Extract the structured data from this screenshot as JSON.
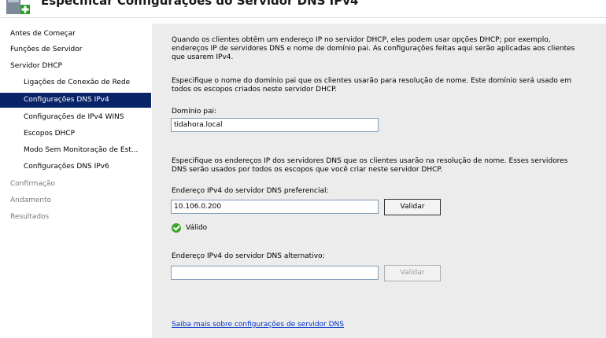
{
  "header": {
    "title": "Especificar Configurações do Servidor DNS IPv4"
  },
  "sidebar": {
    "items": [
      {
        "label": "Antes de Começar",
        "state": "normal"
      },
      {
        "label": "Funções de Servidor",
        "state": "normal"
      },
      {
        "label": "Servidor DHCP",
        "state": "normal"
      },
      {
        "label": "Ligações de Conexão de Rede",
        "state": "normal"
      },
      {
        "label": "Configurações DNS IPv4",
        "state": "selected"
      },
      {
        "label": "Configurações de IPv4 WINS",
        "state": "normal"
      },
      {
        "label": "Escopos DHCP",
        "state": "normal"
      },
      {
        "label": "Modo Sem Monitoração de Est...",
        "state": "normal"
      },
      {
        "label": "Configurações DNS IPv6",
        "state": "normal"
      },
      {
        "label": "Confirmação",
        "state": "disabled"
      },
      {
        "label": "Andamento",
        "state": "disabled"
      },
      {
        "label": "Resultados",
        "state": "disabled"
      }
    ]
  },
  "main": {
    "intro": "Quando os clientes obtêm um endereço IP no servidor DHCP, eles podem usar opções DHCP; por exemplo, endereços IP de servidores DNS e nome de domínio pai. As configurações feitas aqui serão aplicadas aos clientes que usarem IPv4.",
    "domain_instructions": "Especifique o nome do domínio pai que os clientes usarão para resolução de nome. Este domínio será usado em todos os escopos criados neste servidor DHCP.",
    "domain_label": "Domínio pai:",
    "domain_value": "tidahora.local",
    "dns_instructions": "Especifique os endereços IP dos servidores DNS que os clientes usarão na resolução de nome. Esses servidores DNS serão usados por todos os escopos que você criar neste servidor DHCP.",
    "preferred_label": "Endereço IPv4 do servidor DNS preferencial:",
    "preferred_value": "10.106.0.200",
    "validate_label": "Validar",
    "valid_text": "Válido",
    "alternate_label": "Endereço IPv4 do servidor DNS alternativo:",
    "alternate_value": "",
    "validate_alt_label": "Validar",
    "help_link": "Saiba mais sobre configurações de servidor DNS"
  },
  "colors": {
    "selected_bg": "#0a246a",
    "valid_green": "#3fa52b",
    "link": "#0033cc",
    "content_bg": "#ececec"
  }
}
